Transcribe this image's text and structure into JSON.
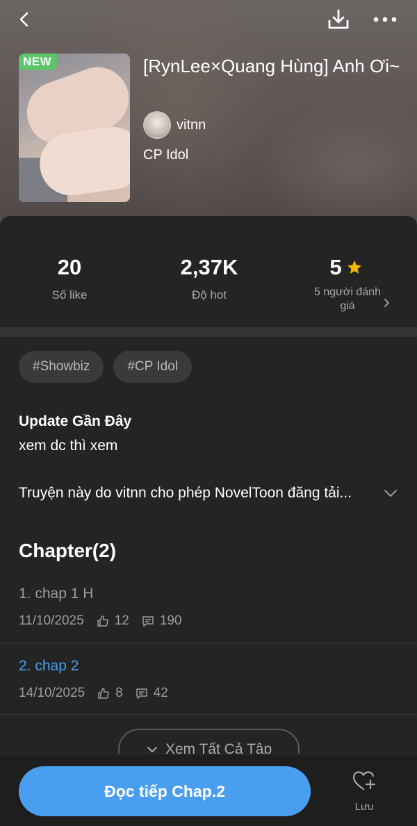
{
  "header": {
    "badge": "NEW",
    "title": "[RynLee×Quang Hùng] Anh Ơi~",
    "author": "vitnn",
    "genre": "CP Idol"
  },
  "stats": {
    "likes_value": "20",
    "likes_label": "Số like",
    "hot_value": "2,37K",
    "hot_label": "Độ hot",
    "rating_value": "5",
    "rating_label": "5 người đánh giá"
  },
  "tags": [
    "#Showbiz",
    "#CP Idol"
  ],
  "update": {
    "heading": "Update Gần Đây",
    "text": "xem dc thì xem"
  },
  "description": "Truyện này do vitnn cho phép NovelToon đăng tải...",
  "chapters": {
    "heading": "Chapter(2)",
    "items": [
      {
        "name": "1. chap 1 H",
        "date": "11/10/2025",
        "likes": "12",
        "comments": "190"
      },
      {
        "name": "2. chap 2",
        "date": "14/10/2025",
        "likes": "8",
        "comments": "42"
      }
    ],
    "see_all": "Xem Tất Cả Tập"
  },
  "bottom": {
    "read_label": "Đọc tiếp Chap.2",
    "save_label": "Lưu"
  },
  "colors": {
    "accent": "#4a9ef0",
    "star": "#f5b400",
    "badge": "#5ec46a",
    "read_chapter": "#9c9c9c",
    "current_chapter": "#4a9ef0"
  },
  "icons": [
    "back-icon",
    "download-icon",
    "more-icon",
    "star-icon",
    "chevron-right-icon",
    "chevron-down-icon",
    "thumbs-up-icon",
    "comment-icon",
    "heart-plus-icon"
  ]
}
